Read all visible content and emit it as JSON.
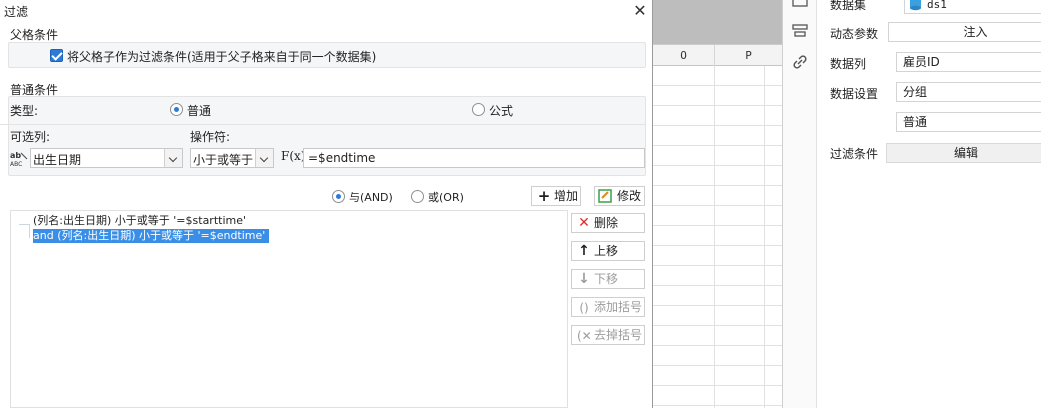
{
  "dialog": {
    "title": "过滤",
    "parent": {
      "group_title": "父格条件",
      "checkbox_label": "将父格子作为过滤条件(适用于父子格来自于同一个数据集)"
    },
    "normal": {
      "group_title": "普通条件",
      "type_label": "类型:",
      "type_option_normal": "普通",
      "type_option_formula": "公式",
      "column_label": "可选列:",
      "operator_label": "操作符:",
      "column_value": "出生日期",
      "operator_value": "小于或等于",
      "formula_icon_text": "F(x)",
      "value_input": "=$endtime"
    },
    "logic": {
      "and_label": "与(AND)",
      "or_label": "或(OR)",
      "add_label": "增加",
      "modify_label": "修改"
    },
    "conditions": [
      "(列名:出生日期) 小于或等于 '=$starttime'",
      "and (列名:出生日期) 小于或等于 '=$endtime'"
    ],
    "actions": {
      "delete": "删除",
      "move_up": "上移",
      "move_down": "下移",
      "add_bracket": "添加括号",
      "remove_bracket": "去掉括号"
    }
  },
  "sheet": {
    "columns": [
      "O",
      "P"
    ]
  },
  "properties": {
    "dataset_label": "数据集",
    "dataset_value": "ds1",
    "dynamic_param_label": "动态参数",
    "dynamic_param_button": "注入",
    "data_column_label": "数据列",
    "data_column_value": "雇员ID",
    "data_setting_label": "数据设置",
    "data_setting_value": "分组",
    "data_setting_value2": "普通",
    "filter_label": "过滤条件",
    "filter_button": "编辑"
  },
  "colors": {
    "accent": "#2e7bd6",
    "selection": "#3a8ee6",
    "delete_red": "#d9302c",
    "modify_green": "#3aa14a"
  }
}
